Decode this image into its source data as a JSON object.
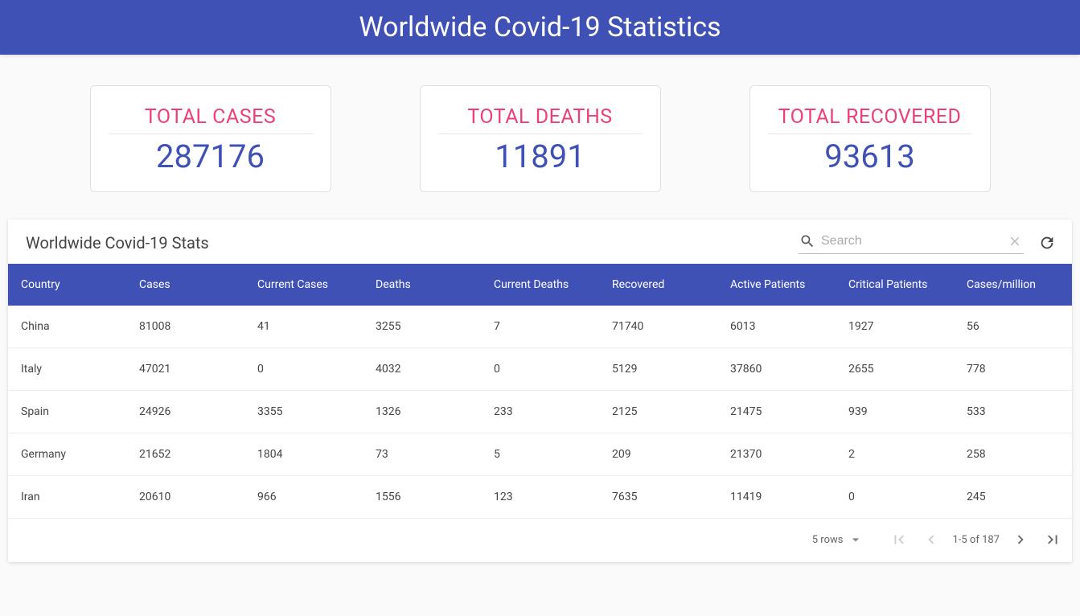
{
  "header": {
    "title": "Worldwide Covid-19 Statistics"
  },
  "stats": {
    "cards": [
      {
        "label": "TOTAL CASES",
        "value": "287176"
      },
      {
        "label": "TOTAL DEATHS",
        "value": "11891"
      },
      {
        "label": "TOTAL RECOVERED",
        "value": "93613"
      }
    ]
  },
  "table": {
    "title": "Worldwide Covid-19 Stats",
    "search_placeholder": "Search",
    "columns": [
      "Country",
      "Cases",
      "Current Cases",
      "Deaths",
      "Current Deaths",
      "Recovered",
      "Active Patients",
      "Critical Patients",
      "Cases/million"
    ],
    "rows": [
      [
        "China",
        "81008",
        "41",
        "3255",
        "7",
        "71740",
        "6013",
        "1927",
        "56"
      ],
      [
        "Italy",
        "47021",
        "0",
        "4032",
        "0",
        "5129",
        "37860",
        "2655",
        "778"
      ],
      [
        "Spain",
        "24926",
        "3355",
        "1326",
        "233",
        "2125",
        "21475",
        "939",
        "533"
      ],
      [
        "Germany",
        "21652",
        "1804",
        "73",
        "5",
        "209",
        "21370",
        "2",
        "258"
      ],
      [
        "Iran",
        "20610",
        "966",
        "1556",
        "123",
        "7635",
        "11419",
        "0",
        "245"
      ]
    ]
  },
  "pagination": {
    "rows_label": "5 rows",
    "range_label": "1-5 of 187"
  }
}
